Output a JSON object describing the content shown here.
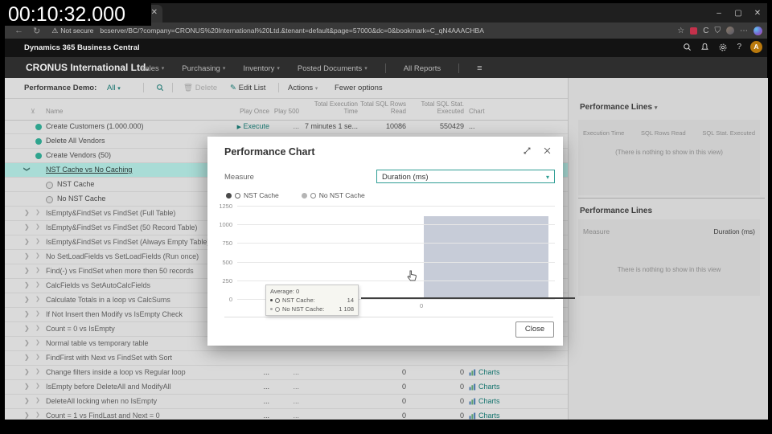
{
  "overlay": {
    "timestamp": "00:10:32.000"
  },
  "browser": {
    "security_label": "Not secure",
    "url": "bcserver/BC/?company=CRONUS%20International%20Ltd.&tenant=default&page=57000&dc=0&bookmark=C_qN4AAACHBA"
  },
  "app_header": {
    "title": "Dynamics 365 Business Central"
  },
  "nav": {
    "company": "CRONUS International Ltd.",
    "items": [
      "Sales",
      "Purchasing",
      "Inventory",
      "Posted Documents",
      "All Reports"
    ]
  },
  "toolbar": {
    "title": "Performance Demo:",
    "filter_value": "All",
    "delete_label": "Delete",
    "edit_list_label": "Edit List",
    "actions_label": "Actions",
    "fewer_options_label": "Fewer options"
  },
  "table": {
    "columns": [
      "Name",
      "Play Once",
      "Play 500",
      "Total Execution Time",
      "Total SQL Rows Read",
      "Total SQL Stat. Executed",
      "Chart"
    ],
    "rows": [
      {
        "type": "dot",
        "name": "Create Customers (1.000.000)",
        "play_once": "Execute",
        "play_500": "...",
        "exec_time": "7 minutes 1 se...",
        "sql_rows": "10086",
        "sql_stat": "550429",
        "chart": "..."
      },
      {
        "type": "dot",
        "name": "Delete All Vendors"
      },
      {
        "type": "dot",
        "name": "Create Vendors (50)"
      },
      {
        "type": "selected",
        "name": "NST Cache vs No Caching"
      },
      {
        "type": "ring",
        "name": "NST Cache"
      },
      {
        "type": "ring",
        "name": "No NST Cache"
      },
      {
        "type": "group",
        "name": "IsEmpty&FindSet vs FindSet (Full Table)"
      },
      {
        "type": "group",
        "name": "IsEmpty&FindSet vs FindSet (50 Record Table)"
      },
      {
        "type": "group",
        "name": "IsEmpty&FindSet vs FindSet (Always Empty Table)"
      },
      {
        "type": "group",
        "name": "No SetLoadFields vs SetLoadFields (Run once)"
      },
      {
        "type": "group",
        "name": "Find(-) vs FindSet when more then 50 records"
      },
      {
        "type": "group",
        "name": "CalcFields vs SetAutoCalcFields"
      },
      {
        "type": "group",
        "name": "Calculate Totals in a loop vs CalcSums"
      },
      {
        "type": "group",
        "name": "If Not Insert then Modify vs IsEmpty Check"
      },
      {
        "type": "group",
        "name": "Count = 0 vs IsEmpty"
      },
      {
        "type": "group",
        "name": "Normal table vs temporary table"
      },
      {
        "type": "group",
        "name": "FindFirst with Next vs FindSet with Sort"
      },
      {
        "type": "group",
        "name": "Change filters inside a loop vs Regular loop",
        "play_once": "...",
        "play_500": "...",
        "sql_rows": "0",
        "sql_stat": "0",
        "chart": "Charts"
      },
      {
        "type": "group",
        "name": "IsEmpty before DeleteAll and ModifyAll",
        "play_once": "...",
        "play_500": "...",
        "sql_rows": "0",
        "sql_stat": "0",
        "chart": "Charts"
      },
      {
        "type": "group",
        "name": "DeleteAll locking when no IsEmpty",
        "play_once": "...",
        "play_500": "...",
        "sql_rows": "0",
        "sql_stat": "0",
        "chart": "Charts"
      },
      {
        "type": "group",
        "name": "Count = 1 vs FindLast and Next = 0",
        "play_once": "...",
        "play_500": "...",
        "sql_rows": "0",
        "sql_stat": "0",
        "chart": "Charts"
      }
    ]
  },
  "modal": {
    "title": "Performance Chart",
    "measure_label": "Measure",
    "measure_value": "Duration (ms)",
    "legend": [
      {
        "label": "NST Cache",
        "dot_color": "#4a4a4a",
        "ring_color": "#666666"
      },
      {
        "label": "No NST Cache",
        "dot_color": "#b5b5b5",
        "ring_color": "#8a8a8a"
      }
    ],
    "x_tick": "0",
    "tooltip": {
      "average": "Average: 0",
      "rows": [
        {
          "label": "NST Cache:",
          "value": "14"
        },
        {
          "label": "No NST Cache:",
          "value": "1 108"
        }
      ]
    },
    "close_label": "Close"
  },
  "factbox": {
    "panel1": {
      "title": "Performance Lines",
      "columns": [
        "Execution Time",
        "SQL Rows Read",
        "SQL Stat. Executed"
      ],
      "empty": "(There is nothing to show in this view)"
    },
    "panel2": {
      "title": "Performance Lines",
      "measure_label": "Measure",
      "measure_value": "Duration (ms)",
      "empty": "There is nothing to show in this view"
    }
  },
  "chart_data": {
    "type": "area",
    "title": "Performance Chart",
    "measure": "Duration (ms)",
    "x": [
      0
    ],
    "series": [
      {
        "name": "NST Cache",
        "values": [
          14
        ]
      },
      {
        "name": "No NST Cache",
        "values": [
          1108
        ]
      }
    ],
    "ylim": [
      0,
      1250
    ],
    "y_ticks": [
      1250,
      1000,
      750,
      500,
      250,
      0
    ],
    "grid": true,
    "legend_position": "top"
  },
  "colors": {
    "accent_teal": "#17756f",
    "selected_row": "#a9dcd6",
    "bar_fill": "#c7ccd8"
  }
}
